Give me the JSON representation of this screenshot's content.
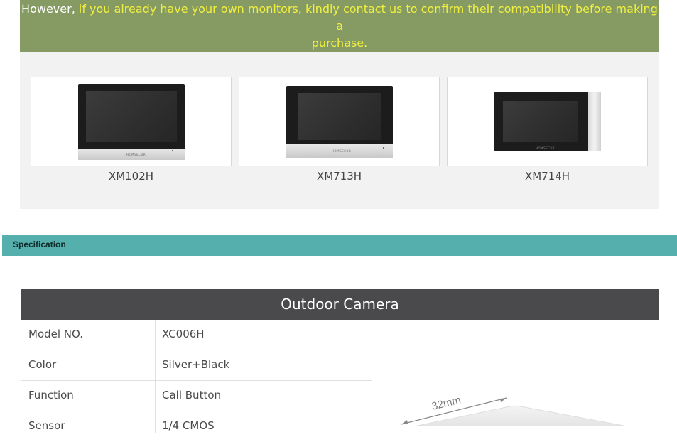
{
  "notice": {
    "lead": "However,",
    "highlight_line1": "if you already have your own monitors, kindly contact us to confirm their compatibility before making a",
    "highlight_line2": "purchase."
  },
  "monitors": [
    {
      "model": "XM102H",
      "brand": "HOMSECUR"
    },
    {
      "model": "XM713H",
      "brand": "HOMSECUR"
    },
    {
      "model": "XM714H",
      "brand": "HOMSECUR"
    }
  ],
  "spec_section": {
    "label": "Specification"
  },
  "spec_table": {
    "title": "Outdoor Camera",
    "rows": [
      {
        "key": "Model NO.",
        "value": "XC006H"
      },
      {
        "key": "Color",
        "value": "Silver+Black"
      },
      {
        "key": "Function",
        "value": "Call Button"
      },
      {
        "key": "Sensor",
        "value": "1/4 CMOS"
      }
    ],
    "dimension_label": "32mm"
  },
  "colors": {
    "notice_bg": "#859b63",
    "highlight": "#f1ef3f",
    "spec_bar": "#55b0ad",
    "table_header": "#4a4a4c"
  }
}
